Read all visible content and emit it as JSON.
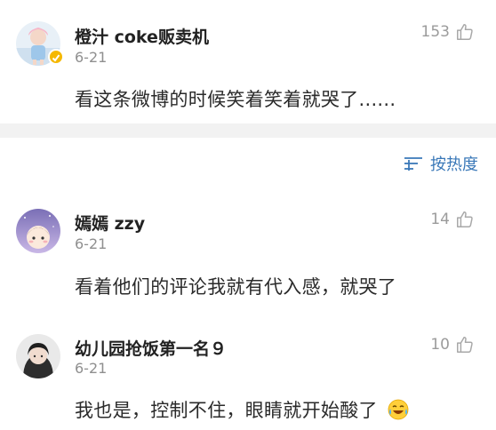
{
  "comments": [
    {
      "username": "橙汁 coke贩卖机",
      "date": "6-21",
      "text": "看这条微博的时候笑着笑着就哭了......",
      "likes": "153"
    },
    {
      "username": "嫣嫣 zzy",
      "date": "6-21",
      "text": "看着他们的评论我就有代入感，就哭了",
      "likes": "14"
    },
    {
      "username": "幼儿园抢饭第一名９",
      "date": "6-21",
      "text": "我也是，控制不住，眼睛就开始酸了",
      "likes": "10"
    }
  ],
  "sort": {
    "label": "按热度",
    "icon": "sort-lines-icon"
  },
  "colors": {
    "link": "#3a78b8",
    "muted": "#8f8f8f",
    "divider": "#f2f2f2",
    "badge": "#f5b800"
  },
  "icons": {
    "like": "thumbs-up-icon",
    "emoji": "crying-laughing-emoji"
  }
}
